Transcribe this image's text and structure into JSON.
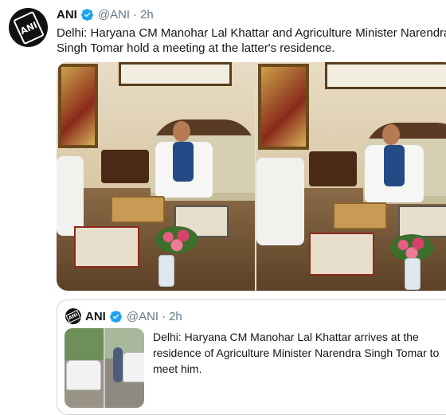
{
  "tweet": {
    "author_name": "ANI",
    "handle": "@ANI",
    "separator": "·",
    "time": "2h",
    "avatar_text": "ANI",
    "text": "Delhi: Haryana CM Manohar Lal Khattar and Agriculture Minister Narendra Singh Tomar hold a meeting at the latter's residence.",
    "photos": [
      "photo-1",
      "photo-2"
    ],
    "verified_color": "#1da1f2"
  },
  "quoted_tweet": {
    "author_name": "ANI",
    "handle": "@ANI",
    "separator": "·",
    "time": "2h",
    "avatar_text": "ANI",
    "text": "Delhi: Haryana CM Manohar Lal Khattar arrives at the residence of Agriculture Minister Narendra Singh Tomar to meet him.",
    "photos": [
      "photo-1",
      "photo-2"
    ]
  }
}
